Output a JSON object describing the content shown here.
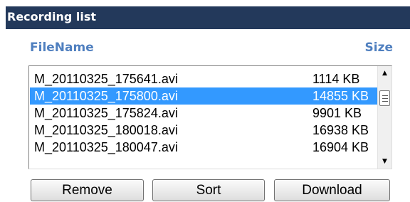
{
  "panel": {
    "title": "Recording list"
  },
  "columns": {
    "filename": "FileName",
    "size": "Size"
  },
  "files": [
    {
      "name": "M_20110325_175641.avi",
      "size": "1114  KB",
      "selected": false
    },
    {
      "name": "M_20110325_175800.avi",
      "size": "14855  KB",
      "selected": true
    },
    {
      "name": "M_20110325_175824.avi",
      "size": "9901  KB",
      "selected": false
    },
    {
      "name": "M_20110325_180018.avi",
      "size": "16938  KB",
      "selected": false
    },
    {
      "name": "M_20110325_180047.avi",
      "size": "16904  KB",
      "selected": false
    }
  ],
  "buttons": {
    "remove": "Remove",
    "sort": "Sort",
    "download": "Download"
  },
  "colors": {
    "header_bg": "#23395b",
    "column_header": "#4f7fbf",
    "selection": "#3399ff"
  },
  "icons": {
    "scroll_up": "▲",
    "scroll_down": "▼"
  }
}
